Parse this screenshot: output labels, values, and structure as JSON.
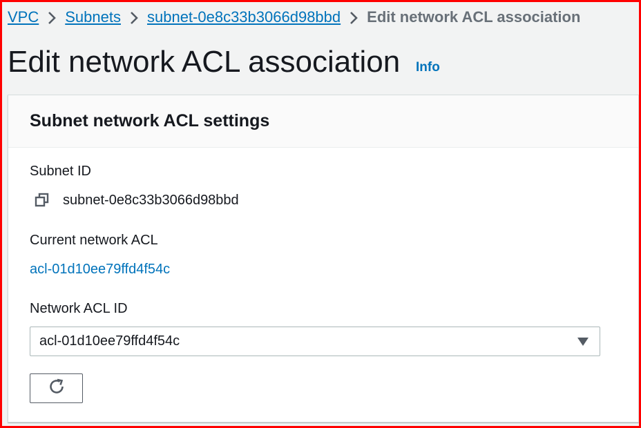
{
  "breadcrumb": {
    "items": [
      "VPC",
      "Subnets",
      "subnet-0e8c33b3066d98bbd"
    ],
    "current": "Edit network ACL association"
  },
  "page": {
    "title": "Edit network ACL association",
    "info_label": "Info"
  },
  "panel": {
    "title": "Subnet network ACL settings",
    "subnet_id_label": "Subnet ID",
    "subnet_id_value": "subnet-0e8c33b3066d98bbd",
    "current_acl_label": "Current network ACL",
    "current_acl_value": "acl-01d10ee79ffd4f54c",
    "acl_id_label": "Network ACL ID",
    "acl_id_selected": "acl-01d10ee79ffd4f54c"
  },
  "icons": {
    "copy": "copy-icon",
    "refresh": "refresh-icon",
    "caret": "caret-down-icon",
    "chevron": "chevron-right-icon"
  },
  "colors": {
    "link": "#0073bb",
    "border": "#aab7b8",
    "frame": "#ff0000"
  }
}
